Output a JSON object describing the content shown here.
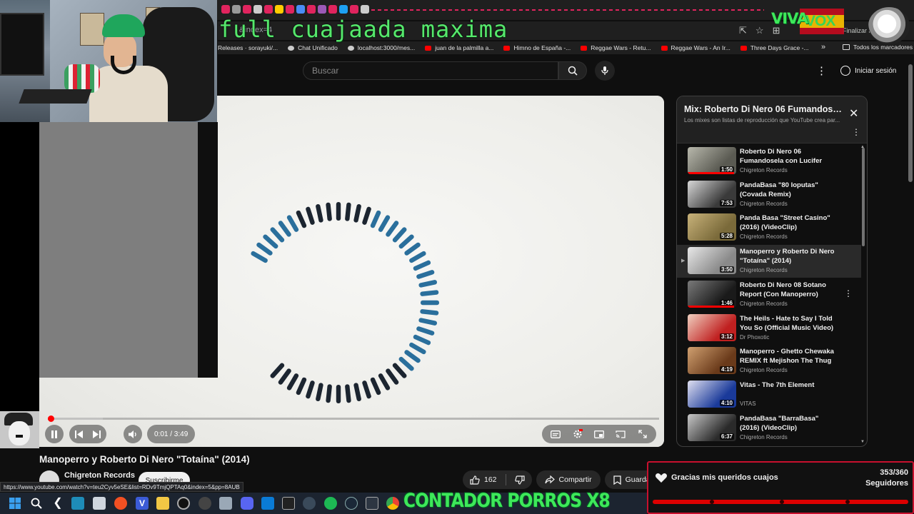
{
  "stream_overlay": {
    "title": "full cuajaada maxima",
    "viva_text": "VIVA",
    "vox_text": "VOX",
    "counter_text": "CONTADOR PORROS X8",
    "follower_goal": {
      "message": "Gracias mis queridos cuajos",
      "count": "353/360",
      "label": "Seguidores",
      "progress": 0.98
    }
  },
  "browser": {
    "url_fragment": "&index=4",
    "profile_action": "Finalizar a",
    "bookmarks": [
      {
        "label": "Releases · sorayuki/...",
        "icon": "none"
      },
      {
        "label": "Chat Unificado",
        "icon": "globe-icon"
      },
      {
        "label": "localhost:3000/mes...",
        "icon": "globe-icon"
      },
      {
        "label": "juan de la palmilla a...",
        "icon": "youtube-icon"
      },
      {
        "label": "Himno de España -...",
        "icon": "youtube-icon"
      },
      {
        "label": "Reggae Wars - Retu...",
        "icon": "youtube-icon"
      },
      {
        "label": "Reggae Wars - An Ir...",
        "icon": "youtube-icon"
      },
      {
        "label": "Three Days Grace -...",
        "icon": "youtube-icon"
      }
    ],
    "all_bookmarks": "Todos los marcadores",
    "status_url": "https://www.youtube.com/watch?v=teu2Cyv5eSE&list=RDv9TmjQPTAq0&index=5&pp=8AUB"
  },
  "youtube": {
    "search_placeholder": "Buscar",
    "signin_label": "Iniciar sesión",
    "video": {
      "title": "Manoperro y Roberto Di Nero \"Totaína\" (2014)",
      "time": "0:01 / 3:49",
      "progress": 0.0045,
      "loaded": 0.09,
      "channel": "Chigreton Records",
      "subscribe_label": "Suscribirme",
      "likes": "162",
      "share_label": "Compartir",
      "save_label": "Guardar"
    },
    "playlist": {
      "title": "Mix: Roberto Di Nero 06 Fumandose...",
      "subtitle": "Los mixes son listas de reproducción que YouTube crea par...",
      "items": [
        {
          "title": "Roberto Di Nero 06 Fumandosela con Lucifer",
          "channel": "Chigreton Records",
          "duration": "1:50",
          "active": false,
          "watched": 0.95,
          "thumb_colors": [
            "#5a5a52",
            "#b8b8ac"
          ]
        },
        {
          "title": "PandaBasa \"80 Ioputas\" (Covada Remix)",
          "channel": "Chigreton Records",
          "duration": "7:53",
          "active": false,
          "watched": 0.0,
          "thumb_colors": [
            "#3a3a3a",
            "#d8d8d8"
          ]
        },
        {
          "title": "Panda Basa \"Street Casino\" (2016) (VideoClip)",
          "channel": "Chigreton Records",
          "duration": "5:28",
          "active": false,
          "watched": 0.0,
          "thumb_colors": [
            "#7a6a3a",
            "#c8b27a"
          ]
        },
        {
          "title": "Manoperro y Roberto Di Nero \"Totaína\" (2014)",
          "channel": "Chigreton Records",
          "duration": "3:50",
          "active": true,
          "watched": 0.0,
          "thumb_colors": [
            "#8a8a8a",
            "#e8e8e8"
          ]
        },
        {
          "title": "Roberto Di Nero 08 Sotano Report (Con Manoperro)",
          "channel": "Chigreton Records",
          "duration": "1:46",
          "active": false,
          "watched": 0.95,
          "thumb_colors": [
            "#1a1a1a",
            "#7a7a7a"
          ]
        },
        {
          "title": "The Heils - Hate to Say I Told You So (Official Music Video)",
          "channel": "Dr Phoxotic",
          "duration": "3:12",
          "active": false,
          "watched": 0.0,
          "thumb_colors": [
            "#c02020",
            "#f0d0c0"
          ]
        },
        {
          "title": "Manoperro - Ghetto Chewaka REMIX ft Mejishon The Thug",
          "channel": "Chigreton Records",
          "duration": "4:19",
          "active": false,
          "watched": 0.0,
          "thumb_colors": [
            "#6a3a1a",
            "#d0a070"
          ]
        },
        {
          "title": "Vitas - The 7th Element",
          "channel": "VITAS",
          "duration": "4:10",
          "active": false,
          "watched": 0.0,
          "thumb_colors": [
            "#1a3a9a",
            "#e0e0f0"
          ]
        },
        {
          "title": "PandaBasa \"BarraBasa\" (2016) (VideoClip)",
          "channel": "Chigreton Records",
          "duration": "6:37",
          "active": false,
          "watched": 0.0,
          "thumb_colors": [
            "#2a2a2a",
            "#c8c8c8"
          ]
        }
      ]
    }
  },
  "colors": {
    "accent_red": "#ff0000",
    "overlay_green": "#56e86c",
    "yt_bg": "#0f0f0f"
  }
}
